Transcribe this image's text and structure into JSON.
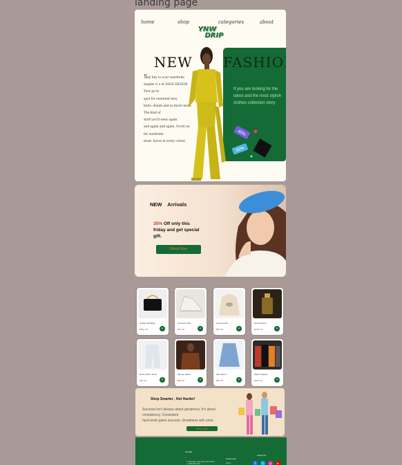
{
  "canvas": {
    "title": "landing page"
  },
  "nav": {
    "home": "home",
    "shop": "shop",
    "categories": "categories",
    "about": "about"
  },
  "brand": {
    "line1": "YNW",
    "line2": "DRIP"
  },
  "hero": {
    "word_new": "NEW",
    "word_fashion": "FASHION",
    "left_drop": "S",
    "left_copy": "ay hey to your wardrobe staples r/ o of ASOS DESIGN. Your go-to",
    "left_lines": [
      "spot for essential tees,",
      "knits, denim and so much more.",
      "The kind of",
      "stuff you'll wear again",
      "and again and again. Scroll on",
      "for wardrobe",
      " must- haves in every colour."
    ],
    "green_text": "If you are looking for the latest and the most stylish clothes collection story",
    "tag1": "40%",
    "tag2": "50%"
  },
  "arrivals": {
    "title": "NEW Arrivals",
    "offer_pct": "35%",
    "offer_rest": "Off only this friday and get special gift.",
    "button": "Shop Now"
  },
  "products": [
    {
      "name": "Classic Handbag",
      "price": "$890 .00"
    },
    {
      "name": "Converse Star",
      "price": "$64 .00"
    },
    {
      "name": "Loop Hoodie",
      "price": "$55 .00"
    },
    {
      "name": "Noir Perfume",
      "price": "$120 .00"
    },
    {
      "name": "Denim Mom Jeans",
      "price": "$48 .00"
    },
    {
      "name": "Sienna Jacket",
      "price": "$98 .00"
    },
    {
      "name": "Skirt Denim",
      "price": "$40 .00"
    },
    {
      "name": "Winter Jackets",
      "price": "$150 .00"
    }
  ],
  "smart": {
    "title": "Shop Smarter , Not Harder!",
    "text_line1": "Success isn't always about greatness. It's about",
    "text_line2": "consistency. Consistent",
    "text_line3": "hard work gains success. Greatness will come.",
    "button": "Shop Now"
  },
  "footer": {
    "contact_title": "Contact",
    "address": "© 140 street road, New York 10014",
    "phone": "+1 555 000 1234",
    "links_title": "Useful Link",
    "link1": "Home",
    "follow_title": "Follow Us"
  },
  "colors": {
    "brand_green": "#146b36",
    "accent_orange": "#e67e22",
    "sale_red": "#c0392b"
  }
}
